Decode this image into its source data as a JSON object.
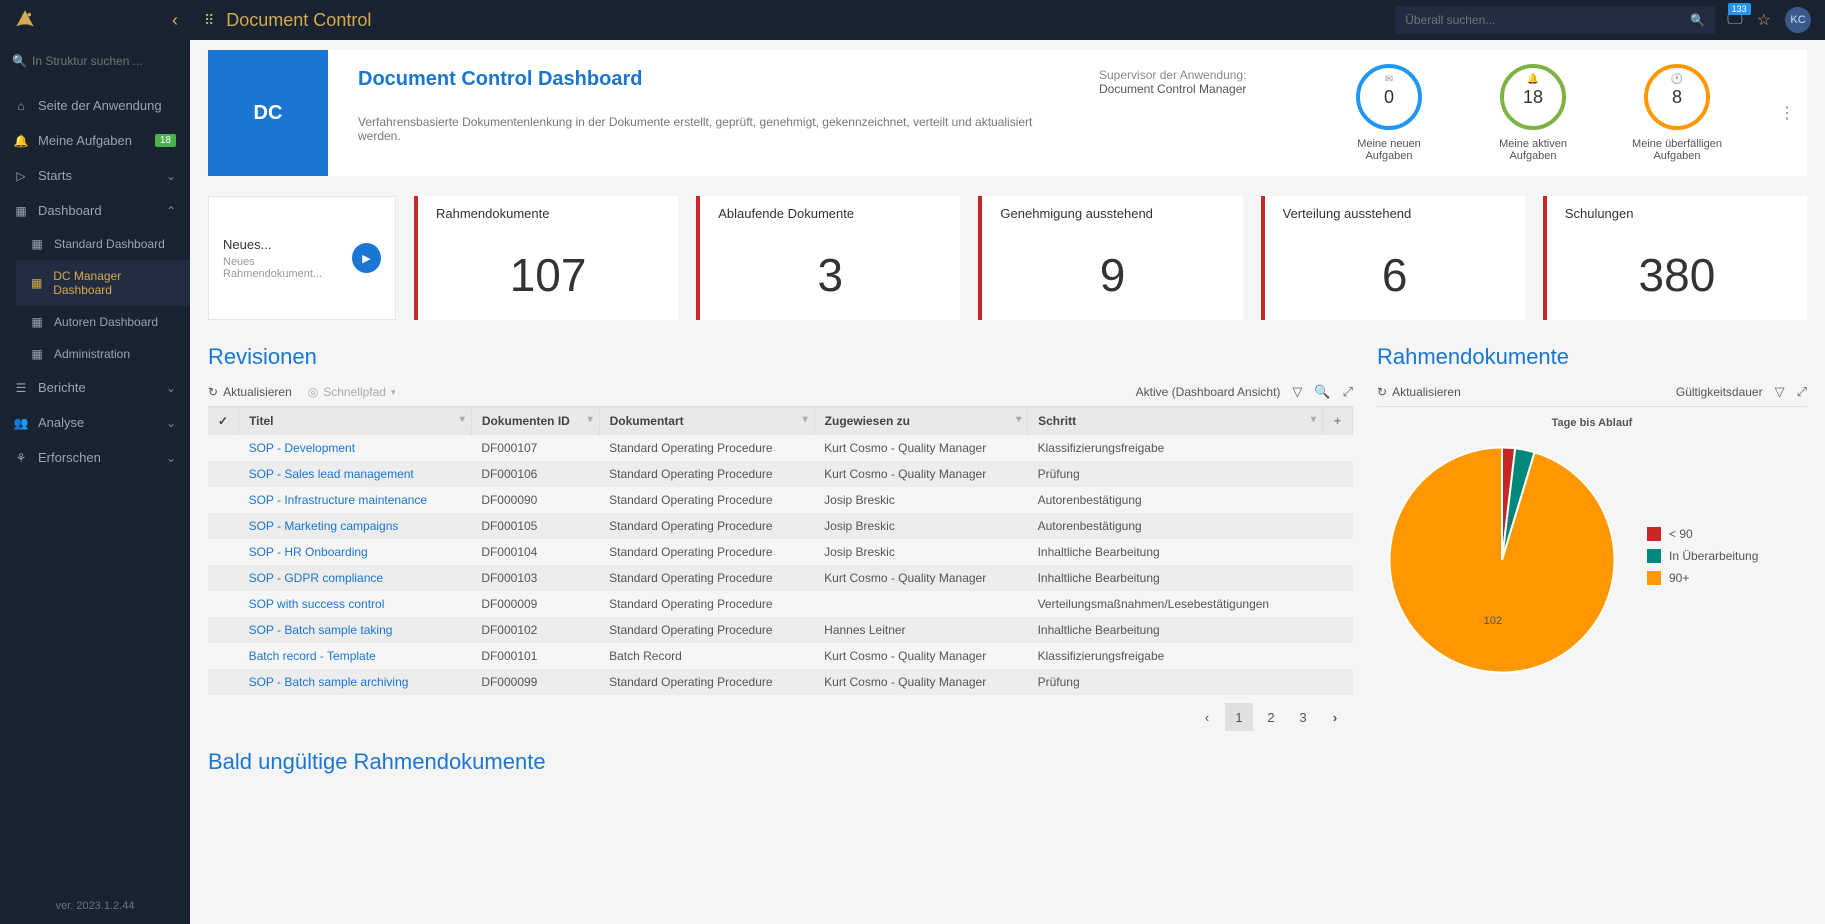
{
  "topbar": {
    "title": "Document Control",
    "search_placeholder": "Überall suchen...",
    "notifications": "133",
    "avatar": "KC"
  },
  "sidebar": {
    "search_placeholder": "In Struktur suchen ...",
    "items": {
      "home": "Seite der Anwendung",
      "tasks": "Meine Aufgaben",
      "tasks_badge": "18",
      "starts": "Starts",
      "dashboard": "Dashboard",
      "sub_standard": "Standard Dashboard",
      "sub_manager": "DC Manager Dashboard",
      "sub_authors": "Autoren Dashboard",
      "sub_admin": "Administration",
      "reports": "Berichte",
      "analysis": "Analyse",
      "explore": "Erforschen"
    },
    "version": "ver. 2023.1.2.44"
  },
  "header": {
    "tile": "DC",
    "title": "Document Control Dashboard",
    "desc": "Verfahrensbasierte Dokumentenlenkung in der Dokumente erstellt, geprüft, genehmigt, gekennzeichnet, verteilt und aktualisiert werden.",
    "supervisor_label": "Supervisor der Anwendung:",
    "supervisor_value": "Document Control Manager",
    "rings": [
      {
        "value": "0",
        "label": "Meine neuen Aufgaben"
      },
      {
        "value": "18",
        "label": "Meine aktiven Aufgaben"
      },
      {
        "value": "8",
        "label": "Meine überfälligen Aufgaben"
      }
    ]
  },
  "tiles": {
    "new_title": "Neues...",
    "new_sub": "Neues Rahmendokument...",
    "stats": [
      {
        "label": "Rahmendokumente",
        "value": "107"
      },
      {
        "label": "Ablaufende Dokumente",
        "value": "3"
      },
      {
        "label": "Genehmigung ausstehend",
        "value": "9"
      },
      {
        "label": "Verteilung ausstehend",
        "value": "6"
      },
      {
        "label": "Schulungen",
        "value": "380"
      }
    ]
  },
  "revisions": {
    "title": "Revisionen",
    "refresh": "Aktualisieren",
    "quickpath": "Schnellpfad",
    "view_label": "Aktive (Dashboard Ansicht)",
    "columns": {
      "title": "Titel",
      "docid": "Dokumenten ID",
      "doctype": "Dokumentart",
      "assigned": "Zugewiesen zu",
      "step": "Schritt"
    },
    "rows": [
      {
        "title": "SOP - Development",
        "id": "DF000107",
        "type": "Standard Operating Procedure",
        "assigned": "Kurt Cosmo - Quality Manager",
        "step": "Klassifizierungsfreigabe"
      },
      {
        "title": "SOP - Sales lead management",
        "id": "DF000106",
        "type": "Standard Operating Procedure",
        "assigned": "Kurt Cosmo - Quality Manager",
        "step": "Prüfung"
      },
      {
        "title": "SOP - Infrastructure maintenance",
        "id": "DF000090",
        "type": "Standard Operating Procedure",
        "assigned": "Josip Breskic",
        "step": "Autorenbestätigung"
      },
      {
        "title": "SOP - Marketing campaigns",
        "id": "DF000105",
        "type": "Standard Operating Procedure",
        "assigned": "Josip Breskic",
        "step": "Autorenbestätigung"
      },
      {
        "title": "SOP - HR Onboarding",
        "id": "DF000104",
        "type": "Standard Operating Procedure",
        "assigned": "Josip Breskic",
        "step": "Inhaltliche Bearbeitung"
      },
      {
        "title": "SOP - GDPR compliance",
        "id": "DF000103",
        "type": "Standard Operating Procedure",
        "assigned": "Kurt Cosmo - Quality Manager",
        "step": "Inhaltliche Bearbeitung"
      },
      {
        "title": "SOP with success control",
        "id": "DF000009",
        "type": "Standard Operating Procedure",
        "assigned": "",
        "step": "Verteilungsmaßnahmen/Lesebestätigungen"
      },
      {
        "title": "SOP - Batch sample taking",
        "id": "DF000102",
        "type": "Standard Operating Procedure",
        "assigned": "Hannes Leitner",
        "step": "Inhaltliche Bearbeitung"
      },
      {
        "title": "Batch record - Template",
        "id": "DF000101",
        "type": "Batch Record",
        "assigned": "Kurt Cosmo - Quality Manager",
        "step": "Klassifizierungsfreigabe"
      },
      {
        "title": "SOP - Batch sample archiving",
        "id": "DF000099",
        "type": "Standard Operating Procedure",
        "assigned": "Kurt Cosmo - Quality Manager",
        "step": "Prüfung"
      }
    ],
    "pages": [
      "1",
      "2",
      "3"
    ]
  },
  "framework": {
    "title": "Rahmendokumente",
    "refresh": "Aktualisieren",
    "validity": "Gültigkeitsdauer",
    "chart_title": "Tage bis Ablauf",
    "legend": {
      "lt90": "< 90",
      "revision": "In Überarbeitung",
      "gt90": "90+"
    }
  },
  "chart_data": {
    "type": "pie",
    "title": "Tage bis Ablauf",
    "series": [
      {
        "name": "< 90",
        "value": 2,
        "color": "#c62828"
      },
      {
        "name": "In Überarbeitung",
        "value": 3,
        "color": "#00897b"
      },
      {
        "name": "90+",
        "value": 102,
        "color": "#ff9800"
      }
    ]
  },
  "bottom_section": "Bald ungültige Rahmendokumente"
}
